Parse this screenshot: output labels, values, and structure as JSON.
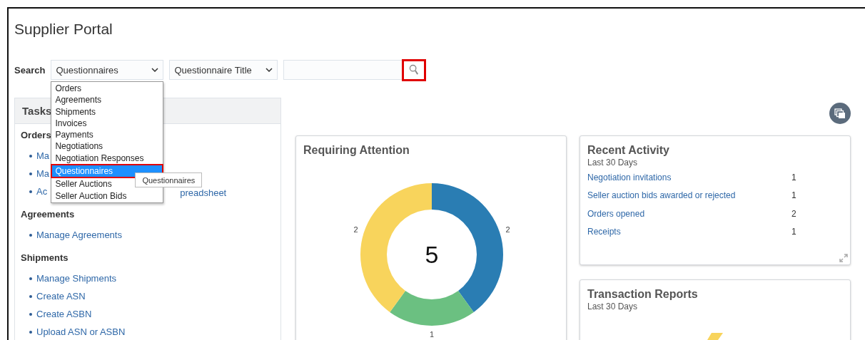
{
  "title": "Supplier Portal",
  "search": {
    "label": "Search",
    "category": "Questionnaires",
    "field": "Questionnaire Title",
    "button_highlighted": true
  },
  "category_menu": {
    "items": [
      {
        "label": "Orders",
        "selected": false,
        "highlighted": false
      },
      {
        "label": "Agreements",
        "selected": false,
        "highlighted": false
      },
      {
        "label": "Shipments",
        "selected": false,
        "highlighted": false
      },
      {
        "label": "Invoices",
        "selected": false,
        "highlighted": false
      },
      {
        "label": "Payments",
        "selected": false,
        "highlighted": false
      },
      {
        "label": "Negotiations",
        "selected": false,
        "highlighted": false
      },
      {
        "label": "Negotiation Responses",
        "selected": false,
        "highlighted": false
      },
      {
        "label": "Questionnaires",
        "selected": true,
        "highlighted": true
      },
      {
        "label": "Seller Auctions",
        "selected": false,
        "highlighted": false
      },
      {
        "label": "Seller Auction Bids",
        "selected": false,
        "highlighted": false
      }
    ]
  },
  "tooltip": "Questionnaires",
  "tasks": {
    "title": "Tasks",
    "sections": [
      {
        "heading": "Orders",
        "links": [
          {
            "parts": [
              "Ma"
            ]
          },
          {
            "parts": [
              "Ma"
            ]
          },
          {
            "parts": [
              "Ac",
              "preadsheet"
            ]
          }
        ]
      },
      {
        "heading": "Agreements",
        "links": [
          {
            "parts": [
              "Manage Agreements"
            ]
          }
        ]
      },
      {
        "heading": "Shipments",
        "links": [
          {
            "parts": [
              "Manage Shipments"
            ]
          },
          {
            "parts": [
              "Create ASN"
            ]
          },
          {
            "parts": [
              "Create ASBN"
            ]
          },
          {
            "parts": [
              "Upload ASN or ASBN"
            ]
          }
        ]
      }
    ]
  },
  "attention": {
    "title": "Requiring Attention",
    "total": "5",
    "chart_data": {
      "type": "donut",
      "values": [
        2,
        1,
        2
      ],
      "colors": [
        "#2a7db3",
        "#6bc081",
        "#f8d45c"
      ],
      "data_labels": true
    }
  },
  "recent_activity": {
    "title": "Recent Activity",
    "subtitle": "Last 30 Days",
    "rows": [
      {
        "label": "Negotiation invitations",
        "count": "1"
      },
      {
        "label": "Seller auction bids awarded or rejected",
        "count": "1"
      },
      {
        "label": "Orders opened",
        "count": "2"
      },
      {
        "label": "Receipts",
        "count": "1"
      }
    ]
  },
  "transaction_reports": {
    "title": "Transaction Reports",
    "subtitle": "Last 30 Days"
  }
}
